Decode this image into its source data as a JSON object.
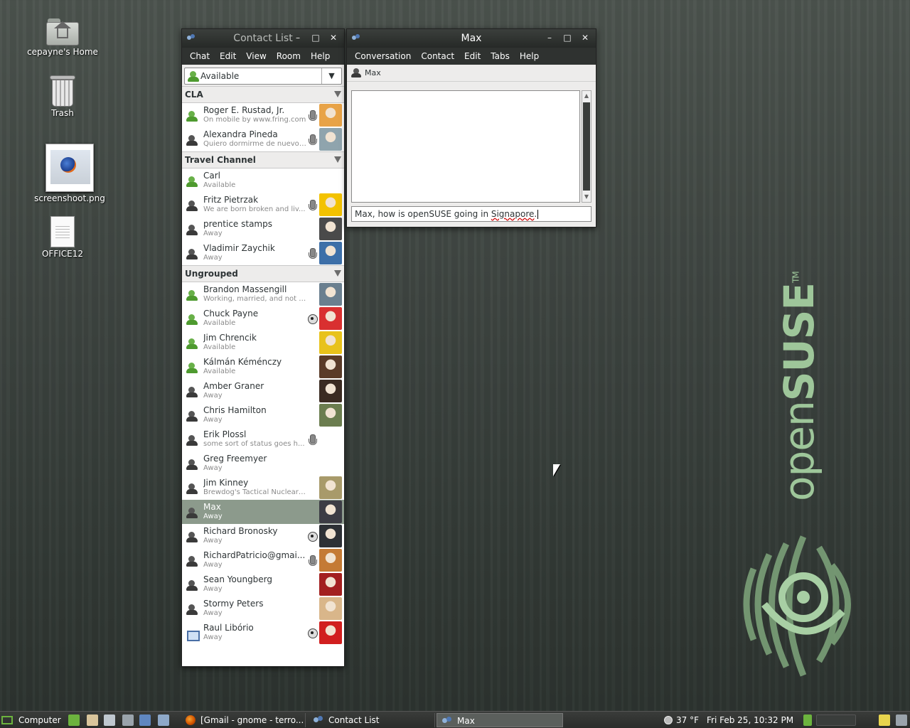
{
  "desktop": {
    "icons": [
      {
        "label": "cepayne's Home"
      },
      {
        "label": "Trash"
      },
      {
        "label": "screenshoot.png"
      },
      {
        "label": "OFFICE12"
      }
    ],
    "brand": {
      "open": "open",
      "suse": "SUSE",
      "tm": "TM"
    }
  },
  "contact_list": {
    "title": "Contact List",
    "menu": [
      {
        "label": "Chat"
      },
      {
        "label": "Edit"
      },
      {
        "label": "View"
      },
      {
        "label": "Room"
      },
      {
        "label": "Help"
      }
    ],
    "status": "Available",
    "groups": [
      {
        "name": "CLA",
        "contacts": [
          {
            "name": "Roger E. Rustad, Jr.",
            "status": "On mobile by www.fring.com",
            "presence": "available",
            "cap": "mic",
            "avatar": "#e8a347"
          },
          {
            "name": "Alexandra Pineda",
            "status": "Quiero dormirme de nuevo ...",
            "presence": "away",
            "cap": "mic",
            "avatar": "#8fa4ad"
          }
        ]
      },
      {
        "name": "Travel Channel",
        "contacts": [
          {
            "name": "Carl",
            "status": "Available",
            "presence": "available",
            "cap": "",
            "avatar": ""
          },
          {
            "name": "Fritz Pietrzak",
            "status": "We are born broken and liv...",
            "presence": "away",
            "cap": "mic",
            "avatar": "#f3c200"
          },
          {
            "name": "prentice stamps",
            "status": "Away",
            "presence": "away",
            "cap": "",
            "avatar": "#4a4a4a"
          },
          {
            "name": "Vladimir Zaychik",
            "status": "Away",
            "presence": "away",
            "cap": "mic",
            "avatar": "#3d6fa8"
          }
        ]
      },
      {
        "name": "Ungrouped",
        "contacts": [
          {
            "name": "Brandon Massengill",
            "status": "Working, married, and not living...",
            "presence": "available",
            "cap": "",
            "avatar": "#6a7f8f"
          },
          {
            "name": "Chuck Payne",
            "status": "Available",
            "presence": "available",
            "cap": "cam",
            "avatar": "#d93030"
          },
          {
            "name": "Jim Chrencik",
            "status": "Available",
            "presence": "available",
            "cap": "",
            "avatar": "#e8c21b"
          },
          {
            "name": "Kálmán Kéménczy",
            "status": "Available",
            "presence": "available",
            "cap": "",
            "avatar": "#5a3b28"
          },
          {
            "name": "Amber Graner",
            "status": "Away",
            "presence": "away",
            "cap": "",
            "avatar": "#3b2b22"
          },
          {
            "name": "Chris Hamilton",
            "status": "Away",
            "presence": "away",
            "cap": "",
            "avatar": "#6b7d4f"
          },
          {
            "name": "Erik Plossl",
            "status": "some sort of status goes h...",
            "presence": "away",
            "cap": "mic",
            "avatar": ""
          },
          {
            "name": "Greg Freemyer",
            "status": "Away",
            "presence": "away",
            "cap": "",
            "avatar": ""
          },
          {
            "name": "Jim Kinney",
            "status": "Brewdog's Tactical Nuclear Pe...",
            "presence": "away",
            "cap": "",
            "avatar": "#a89a6a"
          },
          {
            "name": "Max",
            "status": "Away",
            "presence": "away",
            "cap": "",
            "avatar": "#3c3c44",
            "selected": true
          },
          {
            "name": "Richard Bronosky",
            "status": "Away",
            "presence": "away",
            "cap": "cam",
            "avatar": "#2d3035"
          },
          {
            "name": "RichardPatricio@gmai...",
            "status": "Away",
            "presence": "away",
            "cap": "mic",
            "avatar": "#c47a35"
          },
          {
            "name": "Sean Youngberg",
            "status": "Away",
            "presence": "away",
            "cap": "",
            "avatar": "#a32020"
          },
          {
            "name": "Stormy Peters",
            "status": "Away",
            "presence": "away",
            "cap": "",
            "avatar": "#d9b68a"
          },
          {
            "name": "Raul Libório",
            "status": "Away",
            "presence": "network",
            "cap": "cam",
            "avatar": "#d11f1f"
          }
        ]
      }
    ]
  },
  "chat": {
    "title": "Max",
    "menu": [
      {
        "label": "Conversation"
      },
      {
        "label": "Contact"
      },
      {
        "label": "Edit"
      },
      {
        "label": "Tabs"
      },
      {
        "label": "Help"
      }
    ],
    "tab_label": "Max",
    "input_before": "Max, how is openSUSE going in ",
    "input_misspelled": "Signapore",
    "input_after": "."
  },
  "taskbar": {
    "computer_label": "Computer",
    "tasks": [
      {
        "label": "[Gmail - gnome - terro..."
      },
      {
        "label": "Contact List"
      },
      {
        "label": "Max"
      }
    ],
    "weather": "37 °F",
    "clock": "Fri Feb 25, 10:32 PM"
  },
  "colors": {
    "titlebar": "#2b2e2c",
    "selection": "#8c9a8c",
    "brand_green": "#9ec69a"
  }
}
